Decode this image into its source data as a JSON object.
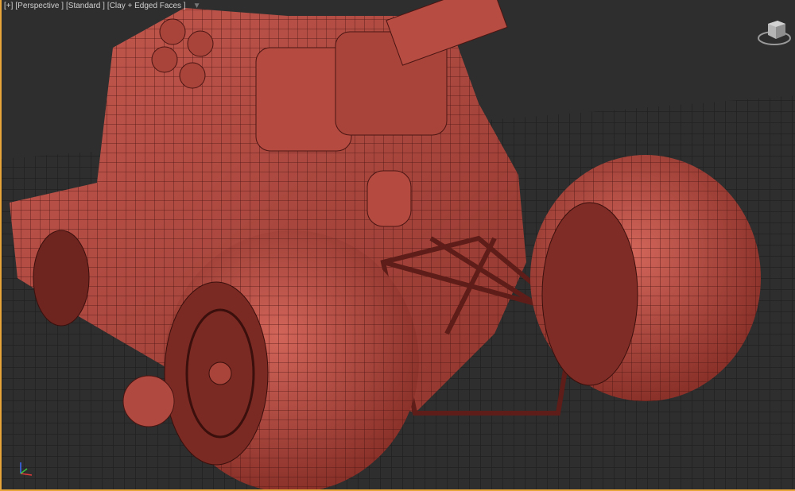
{
  "viewport": {
    "labels": [
      "[+]",
      "[Perspective ]",
      "[Standard ]",
      "[Clay + Edged Faces ]"
    ],
    "filter_icon": "filter-icon",
    "active_border_color": "#e8a53a",
    "model_color": "#b4483f"
  }
}
